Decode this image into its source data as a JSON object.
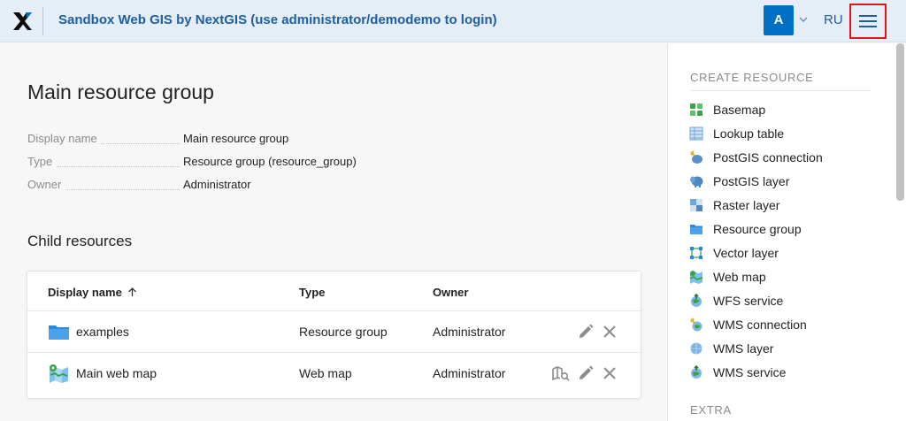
{
  "header": {
    "title": "Sandbox Web GIS by NextGIS (use administrator/demodemo to login)",
    "avatar": "A",
    "lang": "RU"
  },
  "resource": {
    "title": "Main resource group",
    "meta": [
      {
        "key": "Display name",
        "value": "Main resource group"
      },
      {
        "key": "Type",
        "value": "Resource group (resource_group)"
      },
      {
        "key": "Owner",
        "value": "Administrator"
      }
    ]
  },
  "children": {
    "title": "Child resources",
    "columns": [
      "Display name",
      "Type",
      "Owner"
    ],
    "rows": [
      {
        "name": "examples",
        "type": "Resource group",
        "owner": "Administrator"
      },
      {
        "name": "Main web map",
        "type": "Web map",
        "owner": "Administrator"
      }
    ]
  },
  "sidebar": {
    "create_heading": "CREATE RESOURCE",
    "items": [
      {
        "label": "Basemap",
        "icon": "basemap-icon"
      },
      {
        "label": "Lookup table",
        "icon": "lookup-table-icon"
      },
      {
        "label": "PostGIS connection",
        "icon": "postgis-connection-icon"
      },
      {
        "label": "PostGIS layer",
        "icon": "postgis-layer-icon"
      },
      {
        "label": "Raster layer",
        "icon": "raster-layer-icon"
      },
      {
        "label": "Resource group",
        "icon": "folder-icon"
      },
      {
        "label": "Vector layer",
        "icon": "vector-layer-icon"
      },
      {
        "label": "Web map",
        "icon": "web-map-icon"
      },
      {
        "label": "WFS service",
        "icon": "wfs-service-icon"
      },
      {
        "label": "WMS connection",
        "icon": "wms-connection-icon"
      },
      {
        "label": "WMS layer",
        "icon": "wms-layer-icon"
      },
      {
        "label": "WMS service",
        "icon": "wms-service-icon"
      }
    ],
    "extra_heading": "EXTRA"
  },
  "colors": {
    "header_bg": "#e5eef7",
    "accent": "#0070c5",
    "title_blue": "#1f5fa1",
    "highlight_border": "#e0161b"
  }
}
